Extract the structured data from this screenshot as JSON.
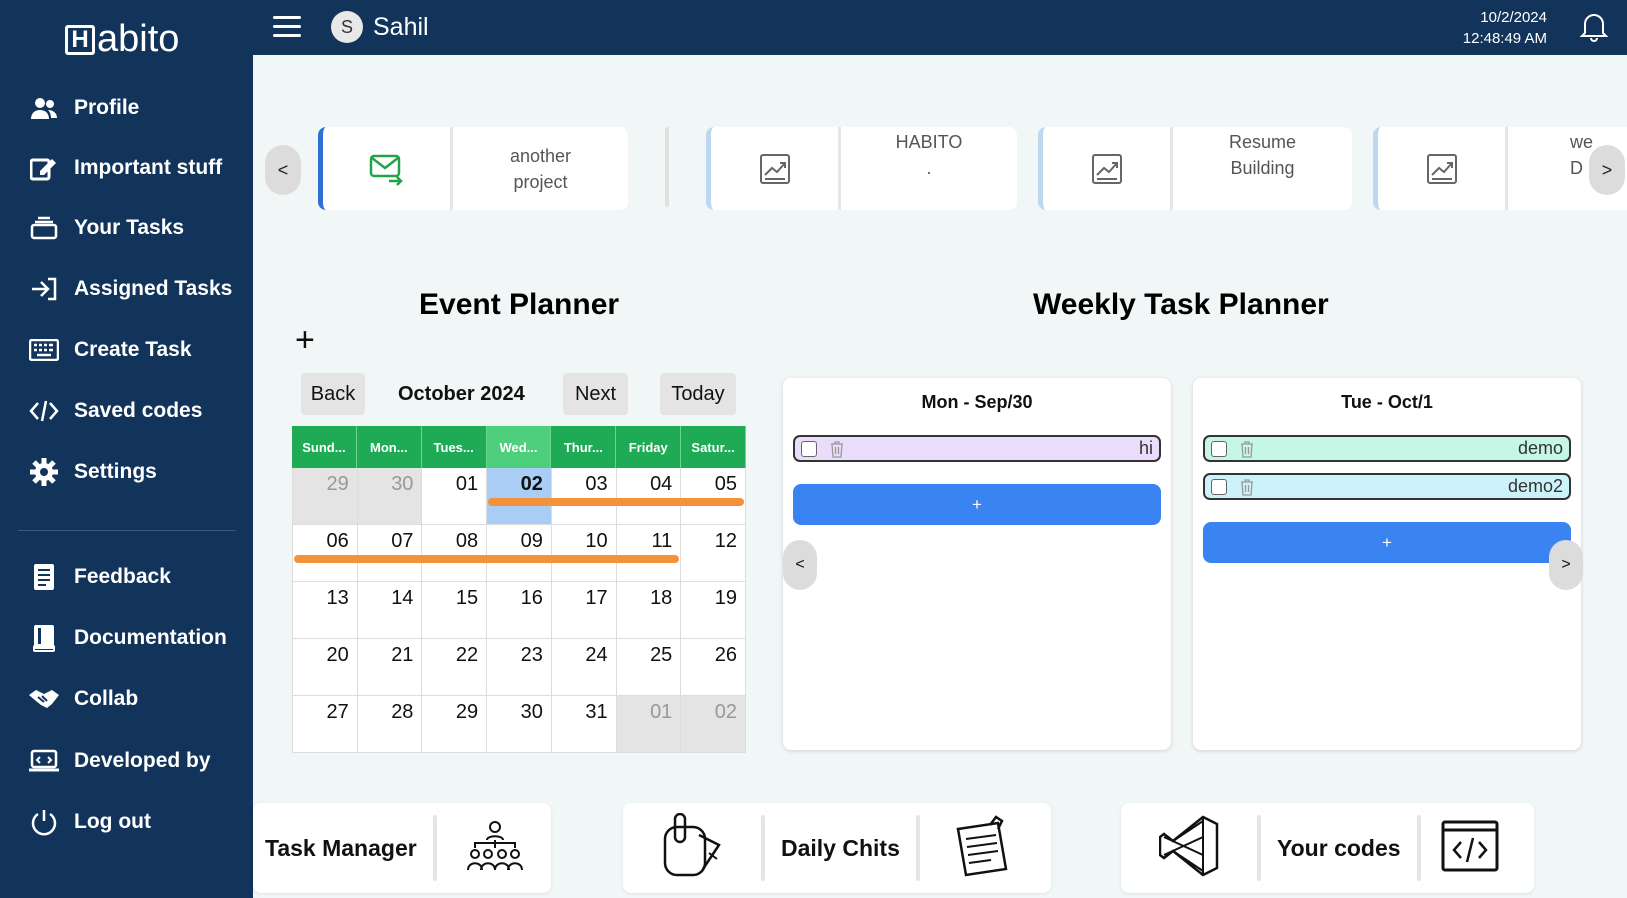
{
  "app": {
    "logo_text": "abito",
    "logo_mark": "H"
  },
  "sidebar": {
    "items": [
      {
        "label": "Profile",
        "icon": "users-icon"
      },
      {
        "label": "Important stuff",
        "icon": "edit-icon"
      },
      {
        "label": "Your Tasks",
        "icon": "stack-icon"
      },
      {
        "label": "Assigned Tasks",
        "icon": "sign-in-icon"
      },
      {
        "label": "Create Task",
        "icon": "keyboard-icon"
      },
      {
        "label": "Saved codes",
        "icon": "code-icon"
      },
      {
        "label": "Settings",
        "icon": "gear-icon"
      },
      {
        "label": "Feedback",
        "icon": "document-icon"
      },
      {
        "label": "Documentation",
        "icon": "book-icon"
      },
      {
        "label": "Collab",
        "icon": "handshake-icon"
      },
      {
        "label": "Developed by",
        "icon": "laptop-icon"
      },
      {
        "label": "Log out",
        "icon": "power-icon"
      }
    ]
  },
  "topbar": {
    "avatar_initial": "S",
    "user_name": "Sahil",
    "date": "10/2/2024",
    "time": "12:48:49 AM"
  },
  "projects": {
    "prev": "<",
    "next": ">",
    "cards": [
      {
        "name_line1": "another",
        "name_line2": "project",
        "icon": "mail-icon"
      },
      {
        "name_line1": "HABITO",
        "name_line2": ".",
        "icon": "chart-icon"
      },
      {
        "name_line1": "Resume",
        "name_line2": "Building",
        "icon": "chart-icon"
      },
      {
        "name_line1": "we",
        "name_line2": "D",
        "icon": "chart-icon"
      }
    ]
  },
  "event_planner": {
    "title": "Event Planner",
    "add": "+",
    "back": "Back",
    "month": "October 2024",
    "next": "Next",
    "today": "Today",
    "weekdays": [
      "Sund...",
      "Mon...",
      "Tues...",
      "Wed...",
      "Thur...",
      "Friday",
      "Satur..."
    ],
    "weeks": [
      [
        "29",
        "30",
        "01",
        "02",
        "03",
        "04",
        "05"
      ],
      [
        "06",
        "07",
        "08",
        "09",
        "10",
        "11",
        "12"
      ],
      [
        "13",
        "14",
        "15",
        "16",
        "17",
        "18",
        "19"
      ],
      [
        "20",
        "21",
        "22",
        "23",
        "24",
        "25",
        "26"
      ],
      [
        "27",
        "28",
        "29",
        "30",
        "31",
        "01",
        "02"
      ]
    ]
  },
  "weekly_planner": {
    "title": "Weekly Task Planner",
    "prev": "<",
    "next": ">",
    "days": [
      {
        "title": "Mon - Sep/30",
        "add": "+",
        "tasks": [
          {
            "text": "hi",
            "color": "#eadcfb"
          }
        ]
      },
      {
        "title": "Tue - Oct/1",
        "add": "+",
        "tasks": [
          {
            "text": "demo",
            "color": "#c5f7e4"
          },
          {
            "text": "demo2",
            "color": "#cdf3fa"
          }
        ]
      }
    ]
  },
  "tiles": [
    {
      "label": "Task Manager",
      "icon": "team-icon"
    },
    {
      "label": "Daily Chits",
      "icon": "mouse-note-icon",
      "icon2": "notes-icon"
    },
    {
      "label": "Your codes",
      "icon": "vscode-icon",
      "icon2": "code-window-icon"
    }
  ],
  "colors": {
    "sidebar": "#12345a",
    "accent_blue": "#3a84f2",
    "calendar_header": "#1faa56",
    "event_bar": "#f39239",
    "today_cell": "#a9cdf5"
  }
}
